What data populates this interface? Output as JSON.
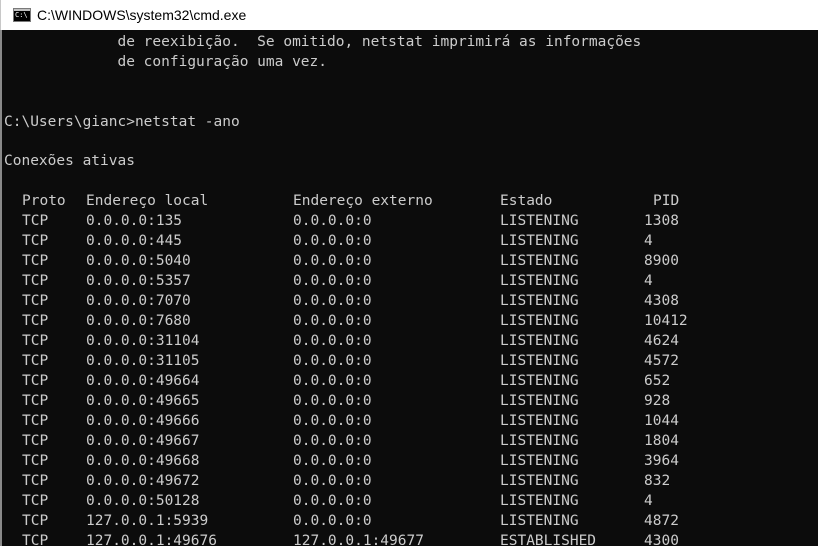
{
  "window": {
    "title": "C:\\WINDOWS\\system32\\cmd.exe"
  },
  "console": {
    "help_line_1": "             de reexibição.  Se omitido, netstat imprimirá as informações",
    "help_line_2": "             de configuração uma vez.",
    "prompt": "C:\\Users\\gianc>netstat -ano",
    "section_title": "Conexões ativas",
    "headers": {
      "proto": "Proto",
      "local": "Endereço local",
      "external": "Endereço externo",
      "state": "Estado",
      "pid": "PID"
    },
    "rows": [
      {
        "proto": "TCP",
        "local": "0.0.0.0:135",
        "external": "0.0.0.0:0",
        "state": "LISTENING",
        "pid": "1308"
      },
      {
        "proto": "TCP",
        "local": "0.0.0.0:445",
        "external": "0.0.0.0:0",
        "state": "LISTENING",
        "pid": "4"
      },
      {
        "proto": "TCP",
        "local": "0.0.0.0:5040",
        "external": "0.0.0.0:0",
        "state": "LISTENING",
        "pid": "8900"
      },
      {
        "proto": "TCP",
        "local": "0.0.0.0:5357",
        "external": "0.0.0.0:0",
        "state": "LISTENING",
        "pid": "4"
      },
      {
        "proto": "TCP",
        "local": "0.0.0.0:7070",
        "external": "0.0.0.0:0",
        "state": "LISTENING",
        "pid": "4308"
      },
      {
        "proto": "TCP",
        "local": "0.0.0.0:7680",
        "external": "0.0.0.0:0",
        "state": "LISTENING",
        "pid": "10412"
      },
      {
        "proto": "TCP",
        "local": "0.0.0.0:31104",
        "external": "0.0.0.0:0",
        "state": "LISTENING",
        "pid": "4624"
      },
      {
        "proto": "TCP",
        "local": "0.0.0.0:31105",
        "external": "0.0.0.0:0",
        "state": "LISTENING",
        "pid": "4572"
      },
      {
        "proto": "TCP",
        "local": "0.0.0.0:49664",
        "external": "0.0.0.0:0",
        "state": "LISTENING",
        "pid": "652"
      },
      {
        "proto": "TCP",
        "local": "0.0.0.0:49665",
        "external": "0.0.0.0:0",
        "state": "LISTENING",
        "pid": "928"
      },
      {
        "proto": "TCP",
        "local": "0.0.0.0:49666",
        "external": "0.0.0.0:0",
        "state": "LISTENING",
        "pid": "1044"
      },
      {
        "proto": "TCP",
        "local": "0.0.0.0:49667",
        "external": "0.0.0.0:0",
        "state": "LISTENING",
        "pid": "1804"
      },
      {
        "proto": "TCP",
        "local": "0.0.0.0:49668",
        "external": "0.0.0.0:0",
        "state": "LISTENING",
        "pid": "3964"
      },
      {
        "proto": "TCP",
        "local": "0.0.0.0:49672",
        "external": "0.0.0.0:0",
        "state": "LISTENING",
        "pid": "832"
      },
      {
        "proto": "TCP",
        "local": "0.0.0.0:50128",
        "external": "0.0.0.0:0",
        "state": "LISTENING",
        "pid": "4"
      },
      {
        "proto": "TCP",
        "local": "127.0.0.1:5939",
        "external": "0.0.0.0:0",
        "state": "LISTENING",
        "pid": "4872"
      },
      {
        "proto": "TCP",
        "local": "127.0.0.1:49676",
        "external": "127.0.0.1:49677",
        "state": "ESTABLISHED",
        "pid": "4300"
      }
    ]
  },
  "colors": {
    "console_background": "#0c0c0c",
    "console_text": "#cccccc",
    "titlebar_background": "#ffffff"
  },
  "icons": {
    "app": "cmd-console-icon"
  }
}
